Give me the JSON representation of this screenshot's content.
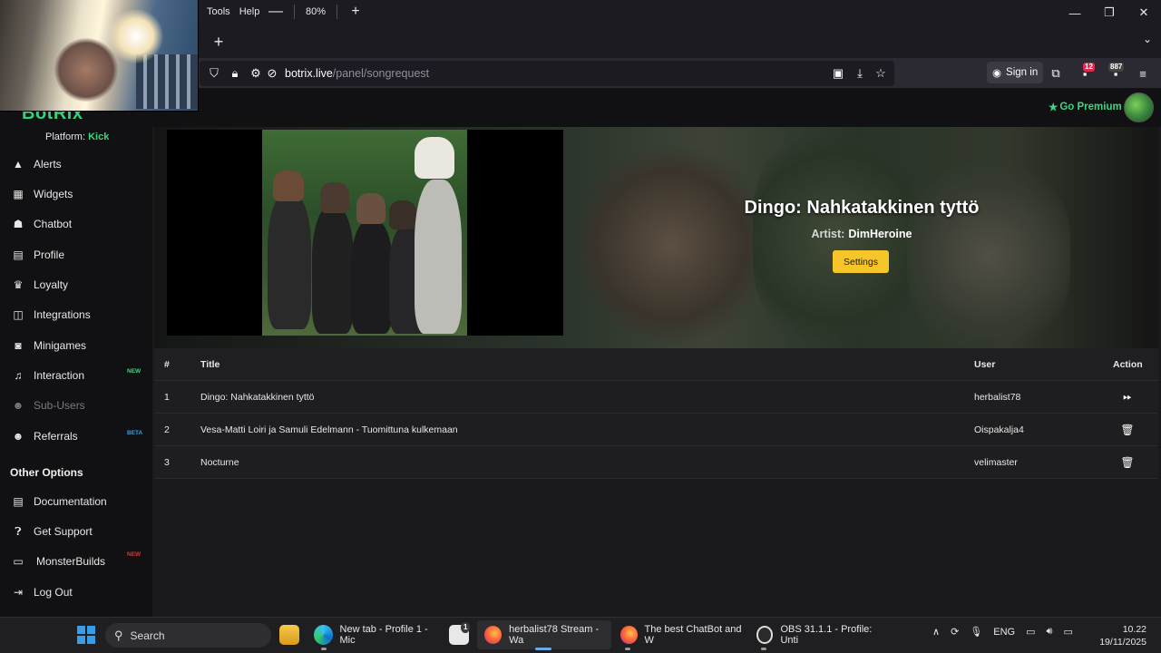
{
  "browser": {
    "menu": [
      "Tools",
      "Help"
    ],
    "zoom": "80%",
    "url_host": "botrix.live",
    "url_path": "/panel/songrequest",
    "sign_in": "Sign in",
    "badge_red": "12",
    "badge_count": "887"
  },
  "app": {
    "logo": "BotRix",
    "go_premium": "Go Premium",
    "platform_label": "Platform:",
    "platform_value": "Kick"
  },
  "sidebar": {
    "items": [
      {
        "label": "Alerts",
        "icon": "alert-icon"
      },
      {
        "label": "Widgets",
        "icon": "widgets-icon"
      },
      {
        "label": "Chatbot",
        "icon": "robot-icon"
      },
      {
        "label": "Profile",
        "icon": "id-card-icon"
      },
      {
        "label": "Loyalty",
        "icon": "trophy-icon"
      },
      {
        "label": "Integrations",
        "icon": "integrations-icon"
      },
      {
        "label": "Minigames",
        "icon": "gamepad-icon"
      },
      {
        "label": "Interaction",
        "icon": "music-icon",
        "tag": "NEW"
      },
      {
        "label": "Sub-Users",
        "icon": "users-icon"
      },
      {
        "label": "Referrals",
        "icon": "referrals-icon",
        "tag": "BETA"
      }
    ],
    "other_heading": "Other Options",
    "other_items": [
      {
        "label": "Documentation",
        "icon": "document-icon"
      },
      {
        "label": "Get Support",
        "icon": "question-icon"
      },
      {
        "label": "MonsterBuilds",
        "icon": "laptop-icon",
        "tag": "NEW"
      },
      {
        "label": "Log Out",
        "icon": "logout-icon"
      }
    ]
  },
  "now_playing": {
    "title": "Dingo: Nahkatakkinen tyttö",
    "artist_label": "Artist:",
    "artist": "DimHeroine",
    "settings_label": "Settings"
  },
  "queue": {
    "headers": {
      "num": "#",
      "title": "Title",
      "user": "User",
      "action": "Action"
    },
    "rows": [
      {
        "num": "1",
        "title": "Dingo: Nahkatakkinen tyttö",
        "user": "herbalist78",
        "action": "skip-icon"
      },
      {
        "num": "2",
        "title": "Vesa-Matti Loiri ja Samuli Edelmann - Tuomittuna kulkemaan",
        "user": "Oispakalja4",
        "action": "trash-icon"
      },
      {
        "num": "3",
        "title": "Nocturne",
        "user": "velimaster",
        "action": "trash-icon"
      }
    ]
  },
  "taskbar": {
    "search": "Search",
    "tasks": [
      "New tab - Profile 1 - Mic",
      "herbalist78 Stream - Wa",
      "The best ChatBot and W",
      "OBS 31.1.1 - Profile: Unti"
    ],
    "store_badge": "1",
    "lang": "ENG",
    "time": "10.22",
    "date": "19/11/2025"
  },
  "colors": {
    "accent_green": "#3cd67f",
    "settings_yellow": "#f5c52a",
    "page_bg": "#1a1a1c"
  }
}
